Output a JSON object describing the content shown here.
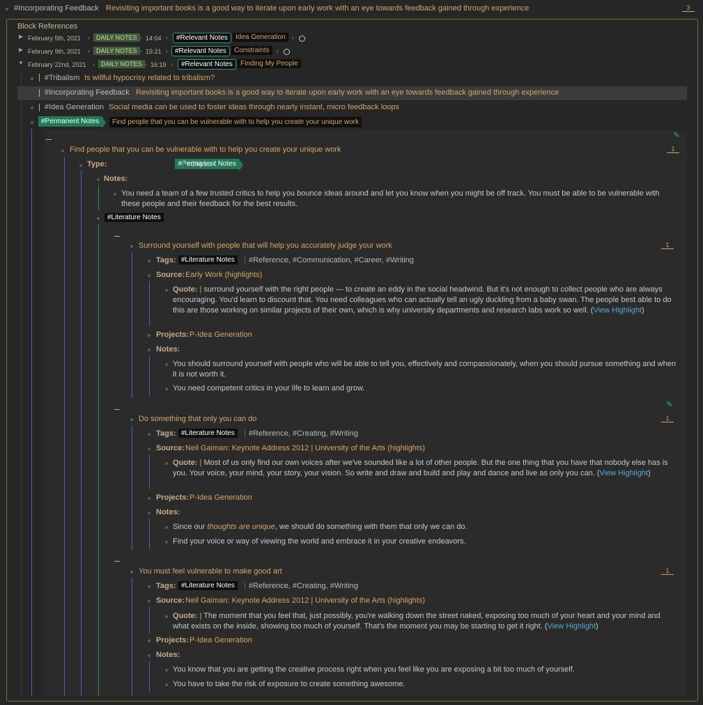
{
  "header": {
    "tag": "#Incorporating Feedback",
    "text": "Revisiting important books is a good way to iterate upon early work with an eye towards feedback gained through experience",
    "count": "3"
  },
  "panel": {
    "title": "Block References",
    "refs": [
      {
        "date": "February 5th, 2021",
        "dn": "DAILY NOTES",
        "time": "14:04",
        "tag": "#Relevant Notes",
        "text": "Idea Generation"
      },
      {
        "date": "February 9th, 2021",
        "dn": "DAILY NOTES",
        "time": "15:21",
        "tag": "#Relevant Notes",
        "text": "Constraints"
      },
      {
        "date": "February 22nd, 2021",
        "dn": "DAILY NOTES",
        "time": "16:19",
        "tag": "#Relevant Notes",
        "text": "Finding My People"
      }
    ],
    "items": [
      {
        "tag": "#Tribalism",
        "text": "Is willful hypocrisy related to tribalism?"
      },
      {
        "tag": "#Incorporating Feedback",
        "text": "Revisiting important books is a good way to iterate upon early work with an eye towards feedback gained through experience"
      },
      {
        "tag": "#Idea Generation",
        "text": "Social media can be used to foster ideas through nearly instant, micro feedback loops"
      }
    ],
    "perm": {
      "tag": "#Permanent Notes",
      "text": "Find people that you can be vulnerable with to help you create your unique work"
    }
  },
  "embed": {
    "title": "Find people that you can be vulnerable with to help you create your unique work",
    "count": "1",
    "type_label": "Type:",
    "type_tag": "#Permanent Notes",
    "type_sep": "|",
    "type_other": "#Slipbox",
    "notes_label": "Notes:",
    "notes_text": "You need a team of a few trusted critics to help you bounce ideas around and let you know when you might be off track. You must be able to be vulnerable with these people and their feedback for the best results.",
    "lit_tag": "#Literature Notes",
    "lit": [
      {
        "title": "Surround yourself with people that will help you accurately judge your work",
        "count": "1",
        "tags_label": "Tags:",
        "tag_main": "#Literature Notes",
        "tags_rest": "#Reference, #Communication, #Career, #Writing",
        "source_label": "Source:",
        "source": "Early Work (highlights)",
        "quote_label": "Quote:",
        "quote": "surround yourself with the right people — to create an eddy in the social headwind. But it's not enough to collect people who are always encouraging. You'd learn to discount that. You need colleagues who can actually tell an ugly duckling from a baby swan. The people best able to do this are those working on similar projects of their own, which is why university departments and research labs work so well. (",
        "view": "View Highlight",
        "close": ")",
        "projects_label": "Projects:",
        "projects": "P-Idea Generation",
        "notes_label": "Notes:",
        "notes": [
          "You should surround yourself with people who will be able to tell you, effectively and compassionately, when you should pursue something and when it is not worth it.",
          "You need competent critics in your life to learn and grow."
        ]
      },
      {
        "title": "Do something that only you can do",
        "count": "1",
        "tags_label": "Tags:",
        "tag_main": "#Literature Notes",
        "tags_rest": "#Reference, #Creating, #Writing",
        "source_label": "Source:",
        "source": "Neil Gaiman: Keynote Address 2012 | University of the Arts (highlights)",
        "quote_label": "Quote:",
        "quote": "Most of us only find our own voices after we've sounded like a lot of other people. But the one thing that you have that nobody else has is you. Your voice, your mind, your story, your vision. So write and draw and build and play and dance and live as only you can. (",
        "view": "View Highlight",
        "close": ")",
        "projects_label": "Projects:",
        "projects": "P-Idea Generation",
        "notes_label": "Notes:",
        "note1_a": "Since our ",
        "note1_em": "thoughts are unique",
        "note1_b": ", we should do something with them that only we can do.",
        "note2": "Find your voice or way of viewing the world and embrace it in your creative endeavors."
      },
      {
        "title": "You must feel vulnerable to make good art",
        "count": "1",
        "tags_label": "Tags:",
        "tag_main": "#Literature Notes",
        "tags_rest": "#Reference, #Creating, #Writing",
        "source_label": "Source:",
        "source": "Neil Gaiman: Keynote Address 2012 | University of the Arts (highlights)",
        "quote_label": "Quote:",
        "quote": "The moment that you feel that, just possibly, you're walking down the street naked, exposing too much of your heart and your mind and what exists on the inside, showing too much of yourself. That's the moment you may be starting to get it right. (",
        "view": "View Highlight",
        "close": ")",
        "projects_label": "Projects:",
        "projects": "P-Idea Generation",
        "notes_label": "Notes:",
        "notes": [
          "You know that you are getting the creative process right when you feel like you are exposing a bit too much of yourself.",
          "You have to take the risk of exposure to create something awesome."
        ]
      }
    ]
  }
}
